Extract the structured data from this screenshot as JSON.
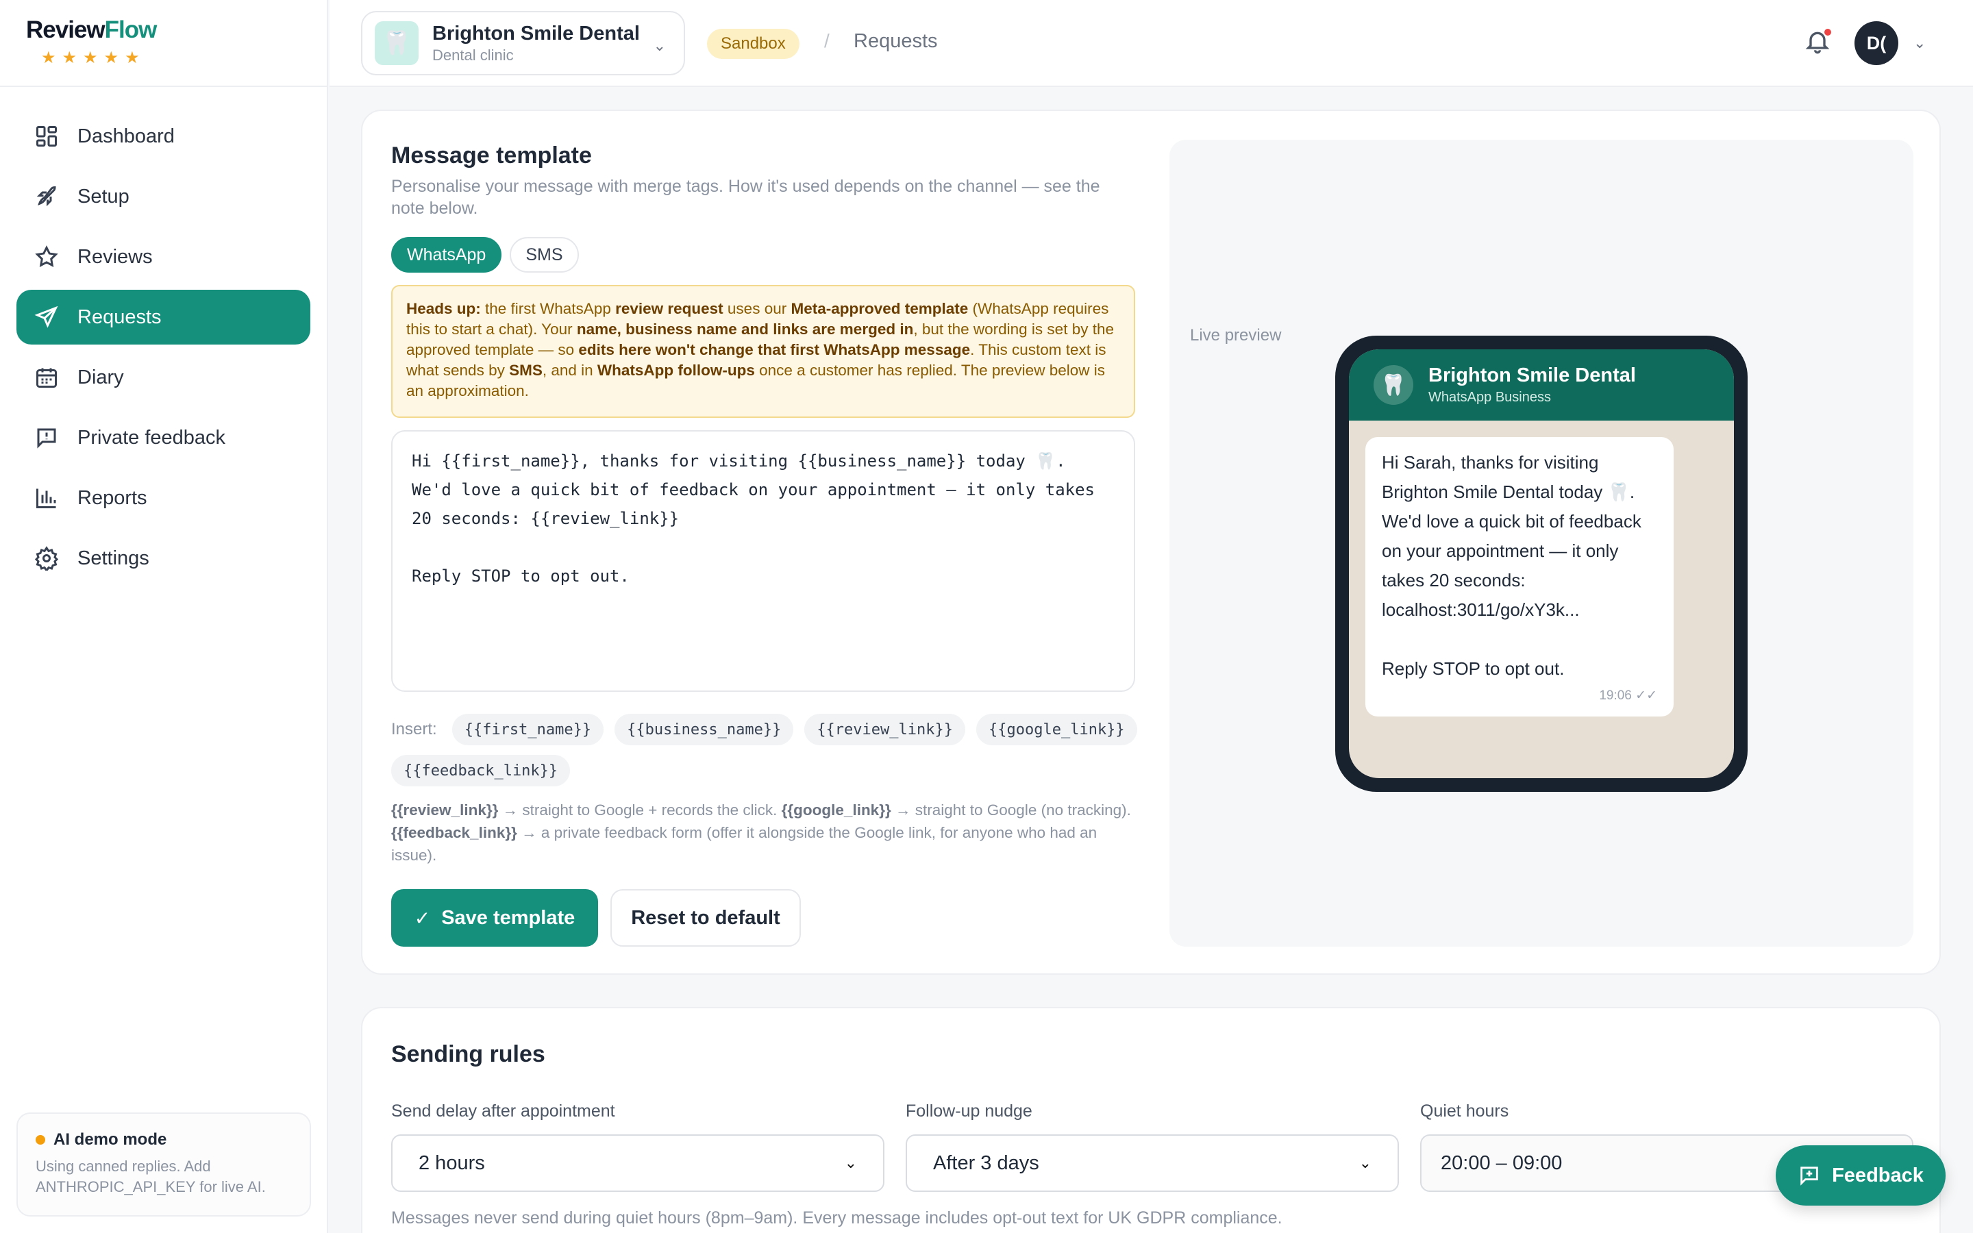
{
  "brand": {
    "logo_part1": "Review",
    "logo_part2": "Flow",
    "stars": "★★★★★"
  },
  "sidebar": {
    "items": [
      {
        "label": "Dashboard",
        "icon": "dashboard-icon"
      },
      {
        "label": "Setup",
        "icon": "rocket-icon"
      },
      {
        "label": "Reviews",
        "icon": "star-icon"
      },
      {
        "label": "Requests",
        "icon": "send-icon",
        "active": true
      },
      {
        "label": "Diary",
        "icon": "calendar-icon"
      },
      {
        "label": "Private feedback",
        "icon": "message-icon"
      },
      {
        "label": "Reports",
        "icon": "bar-chart-icon"
      },
      {
        "label": "Settings",
        "icon": "gear-icon"
      }
    ],
    "demo": {
      "title": "AI demo mode",
      "text": "Using canned replies. Add ANTHROPIC_API_KEY for live AI."
    }
  },
  "header": {
    "business_name": "Brighton Smile Dental",
    "business_type": "Dental clinic",
    "env_badge": "Sandbox",
    "breadcrumb_sep": "/",
    "breadcrumb": "Requests",
    "avatar_initials": "D("
  },
  "template": {
    "title": "Message template",
    "subtitle": "Personalise your message with merge tags. How it's used depends on the channel — see the note below.",
    "tabs": [
      "WhatsApp",
      "SMS"
    ],
    "notice": {
      "p1_bold": "Heads up:",
      "p1": " the first WhatsApp ",
      "p2_bold": "review request",
      "p2": " uses our ",
      "p3_bold": "Meta-approved template",
      "p3": " (WhatsApp requires this to start a chat). Your ",
      "p4_bold": "name, business name and links are merged in",
      "p4": ", but the wording is set by the approved template — so ",
      "p5_bold": "edits here won't change that first WhatsApp message",
      "p5": ". This custom text is what sends by ",
      "p6_bold": "SMS",
      "p6": ", and in ",
      "p7_bold": "WhatsApp follow-ups",
      "p7": " once a customer has replied. The preview below is an approximation."
    },
    "message": "Hi {{first_name}}, thanks for visiting {{business_name}} today 🦷. We'd love a quick bit of feedback on your appointment — it only takes 20 seconds: {{review_link}}\n\nReply STOP to opt out.",
    "insert_label": "Insert:",
    "merge_tags": [
      "{{first_name}}",
      "{{business_name}}",
      "{{review_link}}",
      "{{google_link}}",
      "{{feedback_link}}"
    ],
    "help": {
      "t1_bold": "{{review_link}}",
      "t1": " → straight to Google + records the click. ",
      "t2_bold": "{{google_link}}",
      "t2": " → straight to Google (no tracking). ",
      "t3_bold": "{{feedback_link}}",
      "t3": " → a private feedback form (offer it alongside the Google link, for anyone who had an issue)."
    },
    "save_label": "Save template",
    "reset_label": "Reset to default"
  },
  "preview": {
    "label": "Live preview",
    "chat_name": "Brighton Smile Dental",
    "chat_sub": "WhatsApp Business",
    "bubble_text": "Hi Sarah, thanks for visiting Brighton Smile Dental today 🦷. We'd love a quick bit of feedback on your appointment — it only takes 20 seconds: localhost:3011/go/xY3k...\n\nReply STOP to opt out.",
    "time": "19:06 ✓✓"
  },
  "rules": {
    "title": "Sending rules",
    "delay_label": "Send delay after appointment",
    "delay_value": "2 hours",
    "nudge_label": "Follow-up nudge",
    "nudge_value": "After 3 days",
    "quiet_label": "Quiet hours",
    "quiet_value": "20:00 – 09:00",
    "note": "Messages never send during quiet hours (8pm–9am). Every message includes opt-out text for UK GDPR compliance."
  },
  "feedback_button": "Feedback",
  "colors": {
    "accent": "#14907d",
    "sandbox_bg": "#fdf0c4",
    "notice_bg": "#fdf7e3",
    "whatsapp_header": "#0f6b5b"
  }
}
